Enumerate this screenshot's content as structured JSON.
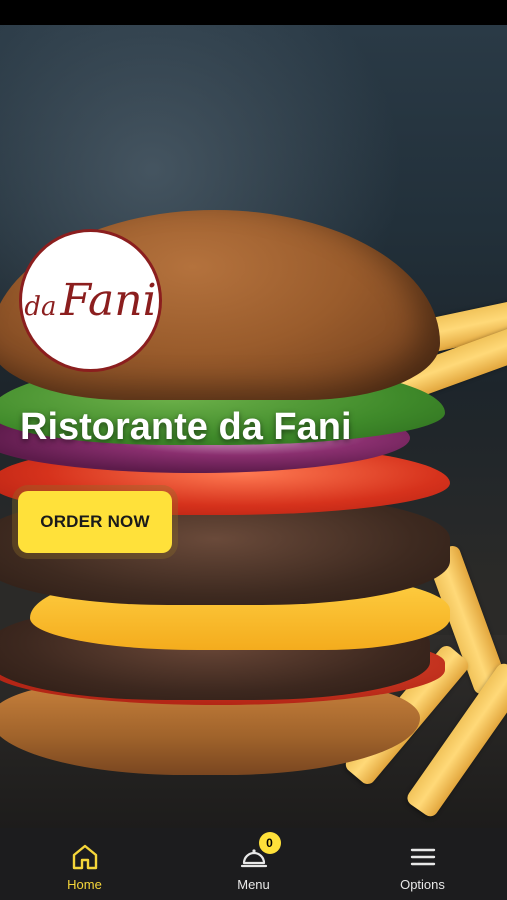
{
  "hero": {
    "logo_text": "da Fani",
    "title": "Ristorante da Fani",
    "order_button_label": "ORDER NOW"
  },
  "bottom_nav": {
    "items": [
      {
        "label": "Home",
        "icon": "home-icon",
        "active": true
      },
      {
        "label": "Menu",
        "icon": "cloche-icon",
        "badge": "0"
      },
      {
        "label": "Options",
        "icon": "hamburger-menu-icon"
      }
    ]
  },
  "colors": {
    "accent": "#ffe13a",
    "active_nav": "#f5d63a",
    "nav_background": "#1c1c1e",
    "logo_red": "#8b1e1e"
  }
}
